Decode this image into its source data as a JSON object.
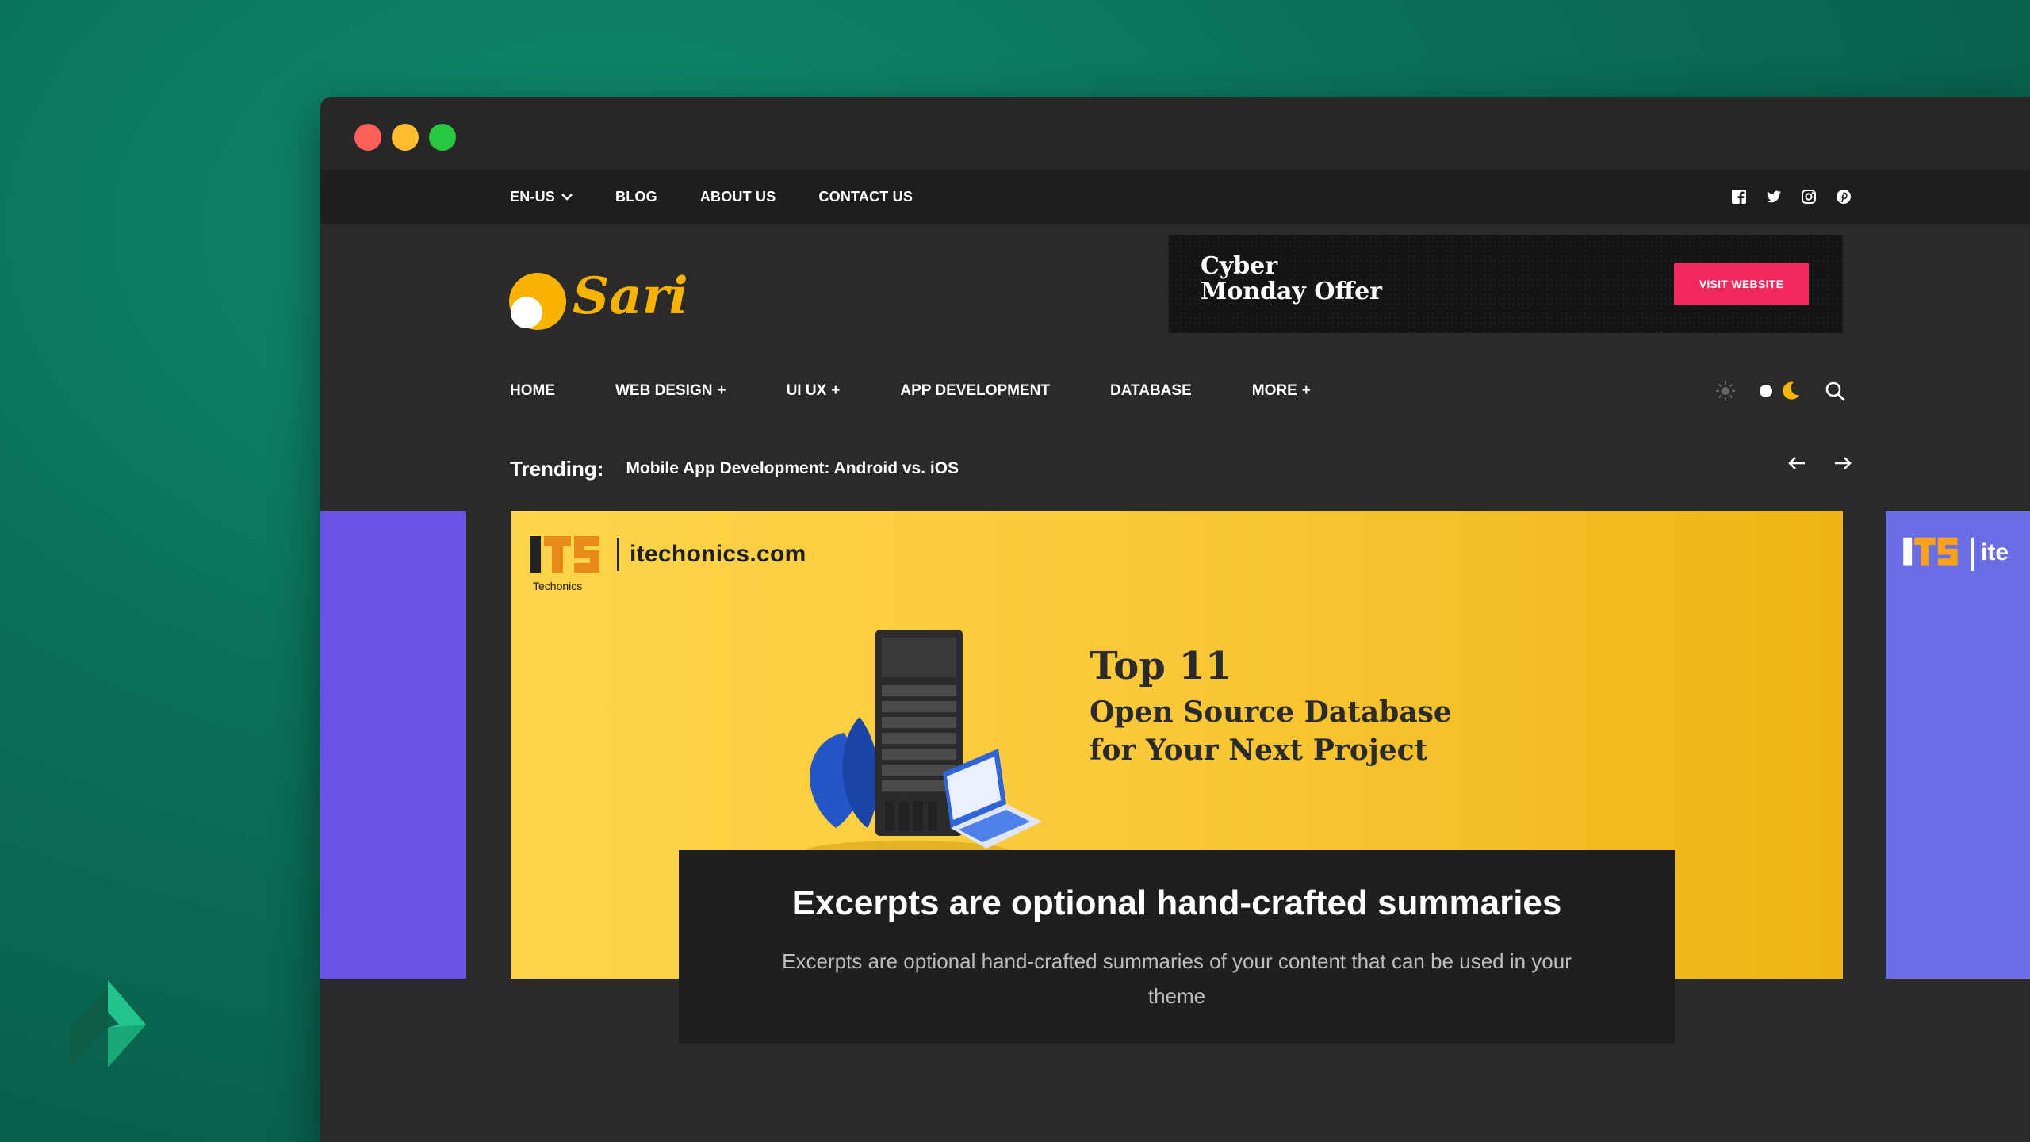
{
  "window": {
    "controls": [
      "close",
      "minimize",
      "maximize"
    ]
  },
  "topbar": {
    "language": "EN-US",
    "links": [
      "BLOG",
      "ABOUT US",
      "CONTACT US"
    ],
    "social": [
      "facebook-icon",
      "twitter-icon",
      "instagram-icon",
      "pinterest-icon"
    ]
  },
  "brand": {
    "name": "Sari",
    "color": "#f7b300"
  },
  "ad": {
    "line1": "Cyber",
    "line2": "Monday Offer",
    "button": "VISIT WEBSITE",
    "button_color": "#f2285e"
  },
  "nav": {
    "items": [
      {
        "label": "HOME",
        "active": true,
        "has_submenu": false
      },
      {
        "label": "WEB DESIGN",
        "active": false,
        "has_submenu": true
      },
      {
        "label": "UI UX",
        "active": false,
        "has_submenu": true
      },
      {
        "label": "APP DEVELOPMENT",
        "active": false,
        "has_submenu": false
      },
      {
        "label": "DATABASE",
        "active": false,
        "has_submenu": false
      },
      {
        "label": "MORE",
        "active": false,
        "has_submenu": true
      }
    ],
    "accent": "#f7b300"
  },
  "trending": {
    "label": "Trending:",
    "headline": "Mobile App Development: Android vs. iOS"
  },
  "slide": {
    "logo_letters": "ITS",
    "logo_sub": "Techonics",
    "site": "itechonics.com",
    "heading_top": "Top 11",
    "heading_line1": "Open Source Database",
    "heading_line2": "for Your Next Project",
    "peek_site": "ite"
  },
  "excerpt": {
    "title": "Excerpts are optional hand-crafted summaries",
    "body": "Excerpts are optional hand-crafted summaries of your content that can be used in your theme"
  }
}
